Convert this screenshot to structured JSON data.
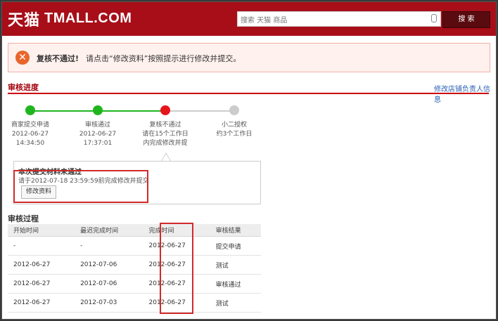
{
  "header": {
    "logo_cn": "天猫",
    "logo_en": "TMALL.COM",
    "search_placeholder": "搜索 天猫 商品",
    "search_button": "搜 索"
  },
  "alert": {
    "title": "复核不通过!",
    "message": "请点击“修改资料”按照提示进行修改并提交。"
  },
  "progress_section": {
    "title": "审核进度",
    "edit_link": "修改店铺负责人信息",
    "steps": [
      {
        "name": "商家提交申请",
        "line1": "2012-06-27",
        "line2": "14:34:50",
        "status": "done"
      },
      {
        "name": "审核通过",
        "line1": "2012-06-27",
        "line2": "17:37:01",
        "status": "done"
      },
      {
        "name": "复核不通过",
        "line1": "请在15个工作日",
        "line2": "内完成修改并提",
        "status": "failed"
      },
      {
        "name": "小二授权",
        "line1": "约3个工作日",
        "line2": "",
        "status": "pending"
      }
    ]
  },
  "info_box": {
    "title": "本次提交材料未通过",
    "text": "请于2012-07-18 23:59:59前完成修改并提交",
    "button": "修改资料"
  },
  "history": {
    "title": "审核过程",
    "columns": [
      "开始时间",
      "最迟完成时间",
      "完成时间",
      "审核结果"
    ],
    "rows": [
      [
        "-",
        "-",
        "2012-06-27",
        "提交申请"
      ],
      [
        "2012-06-27",
        "2012-07-06",
        "2012-06-27",
        "测试"
      ],
      [
        "2012-06-27",
        "2012-07-06",
        "2012-06-27",
        "审核通过"
      ],
      [
        "2012-06-27",
        "2012-07-03",
        "2012-06-27",
        "测试"
      ]
    ]
  },
  "colors": {
    "brand": "#a70e18",
    "done": "#1fb51f",
    "failed": "#e8141c",
    "pending": "#cccccc",
    "highlight": "#d12a2a"
  }
}
